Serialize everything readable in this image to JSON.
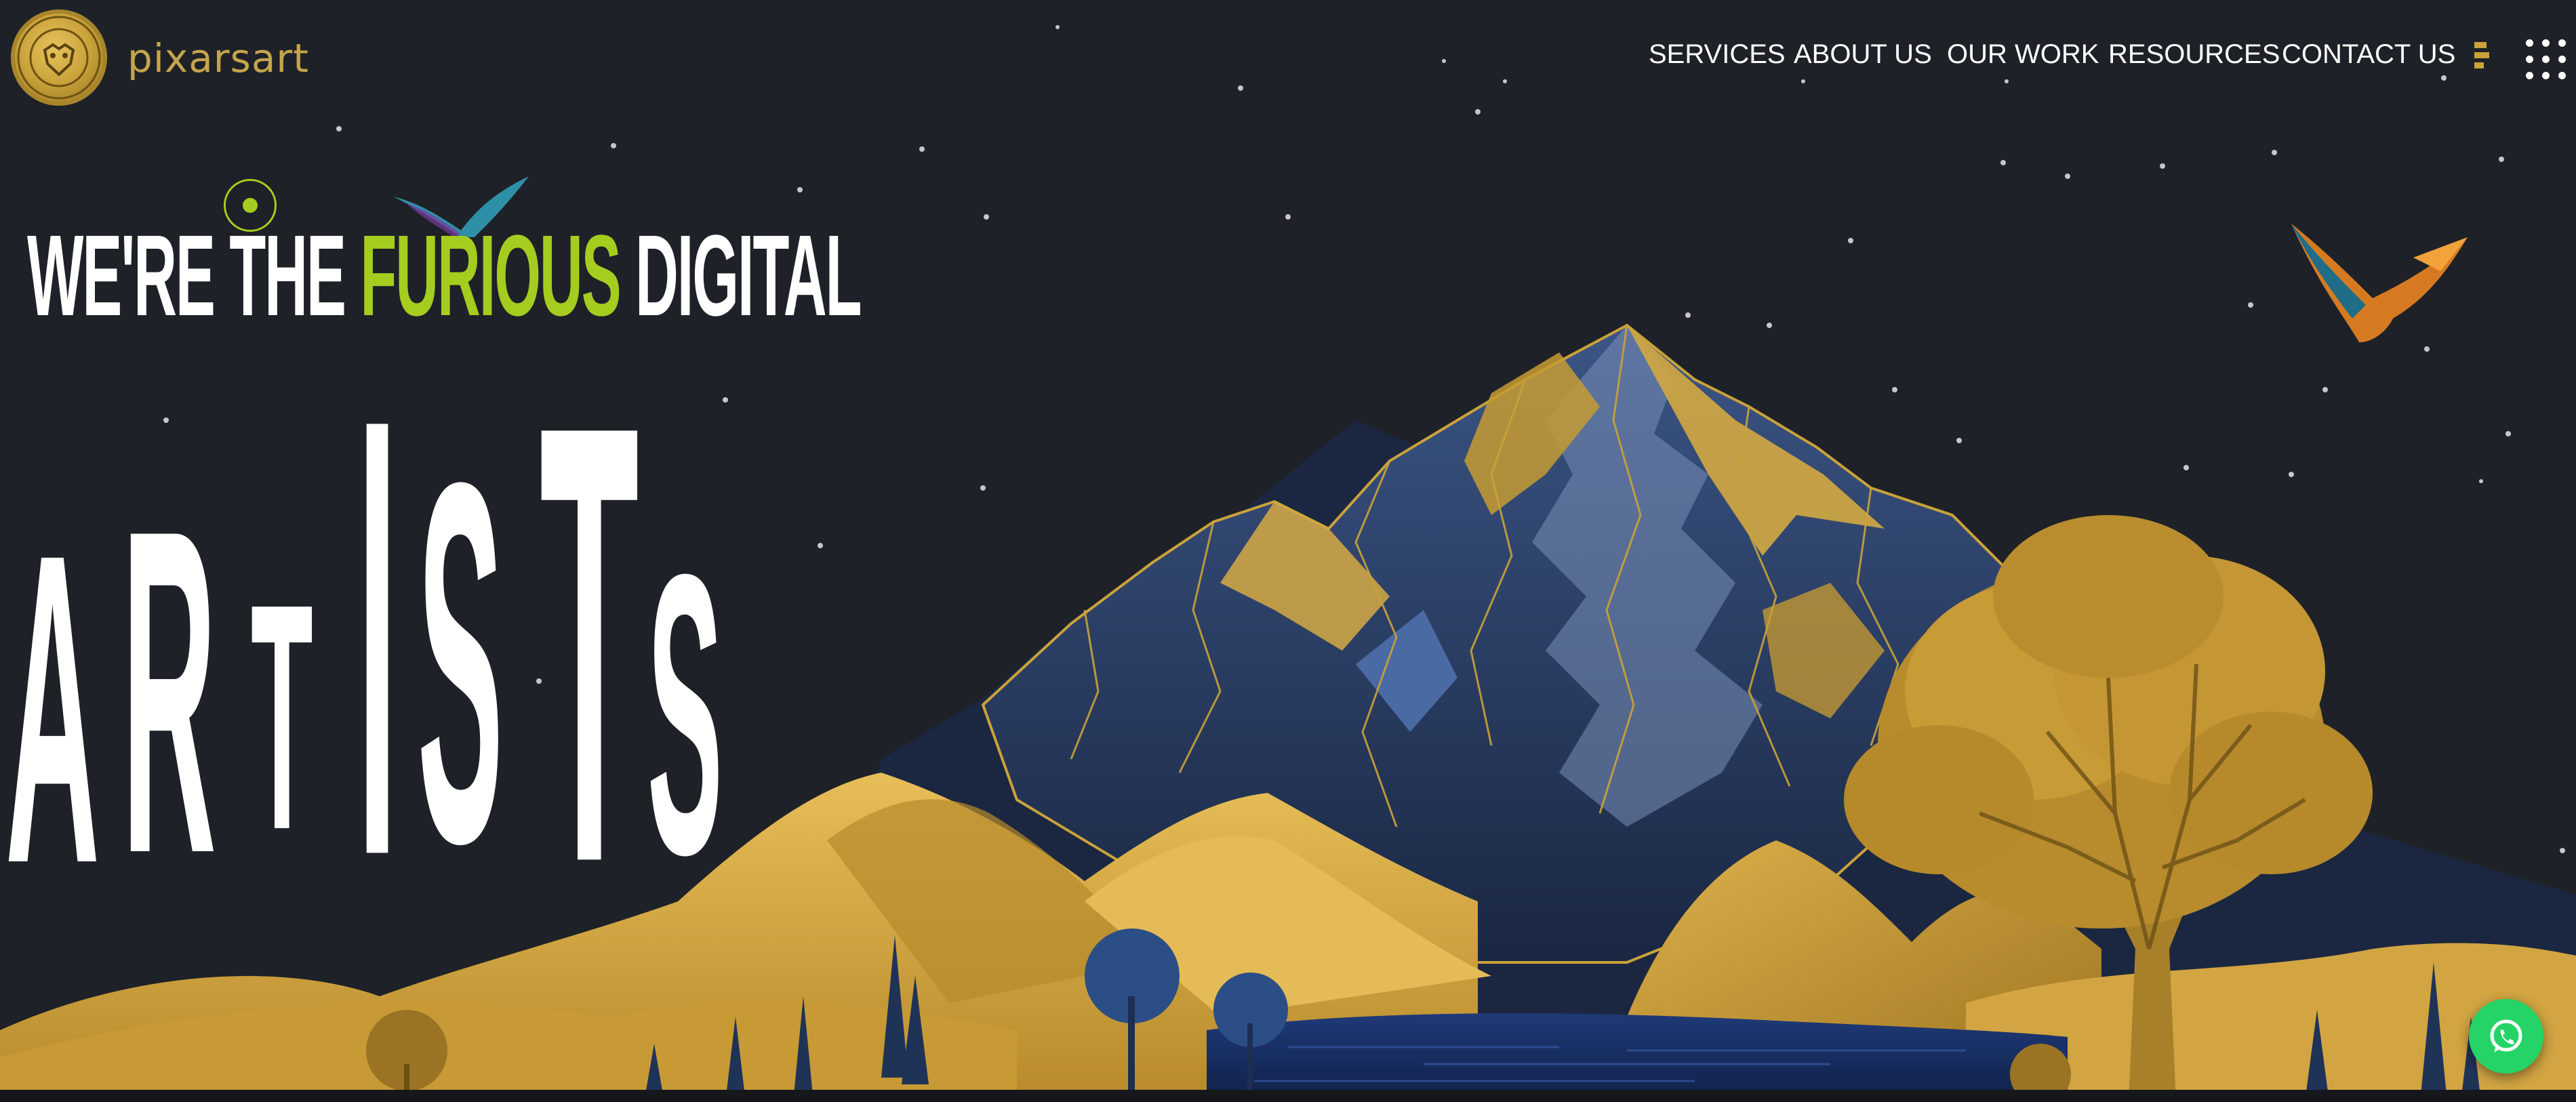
{
  "header": {
    "brand_name": "pixarsart",
    "nav": [
      {
        "label": "SERVICES"
      },
      {
        "label": "ABOUT US"
      },
      {
        "label": "OUR WORK"
      },
      {
        "label": "RESOURCES"
      },
      {
        "label": "CONTACT US"
      }
    ],
    "icons": [
      "hamburger-menu-icon",
      "grid-menu-icon"
    ]
  },
  "hero": {
    "line1_prefix": "WE'RE THE",
    "line1_accent": "FURIOUS",
    "line1_suffix": "DIGITAL",
    "letters": [
      "A",
      "R",
      "T",
      "I",
      "S",
      "T",
      "S"
    ]
  },
  "floating_button": {
    "icon": "whatsapp-icon"
  },
  "colors": {
    "background": "#1e2127",
    "accent_green": "#a5cd1f",
    "gold": "#c9a23a",
    "navy": "#2a3f66",
    "whatsapp_green": "#25d366"
  }
}
